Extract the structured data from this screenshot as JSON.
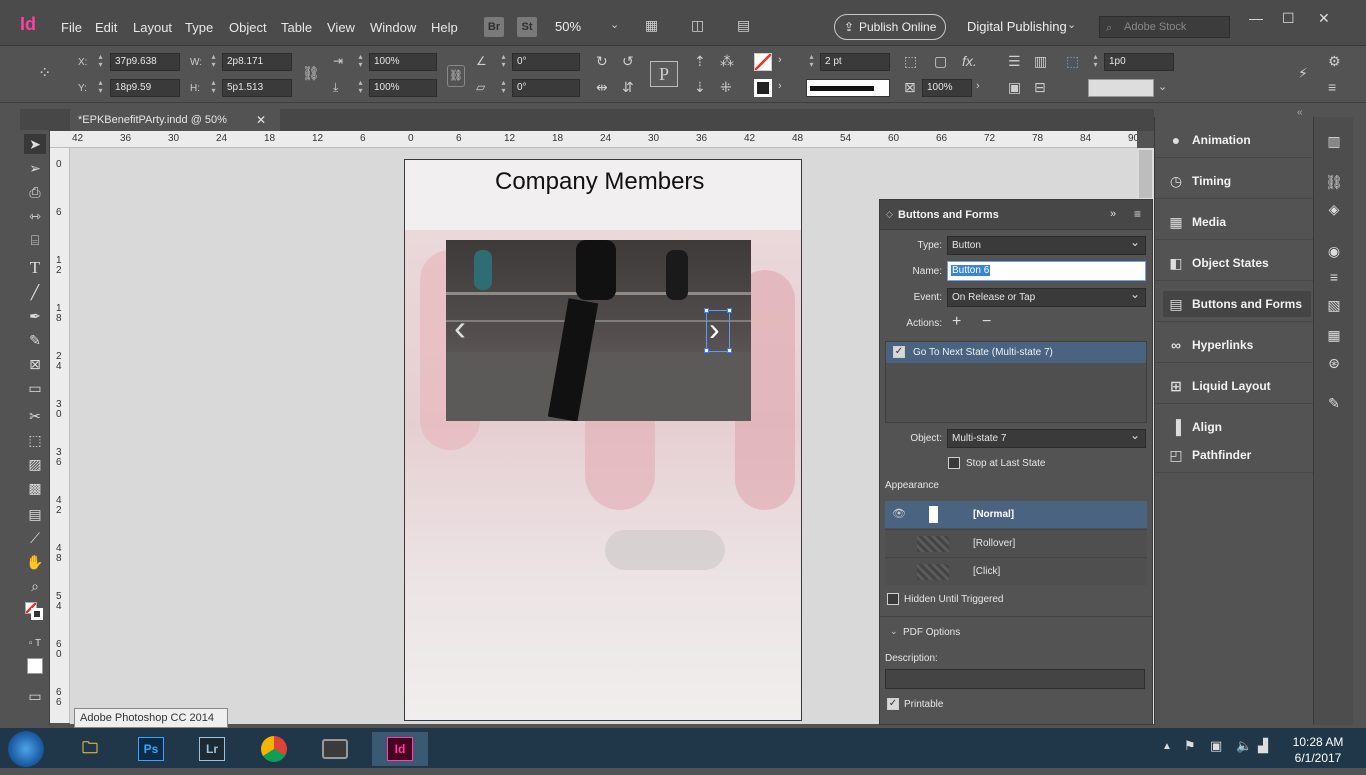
{
  "app": {
    "logo": "Id",
    "menus": [
      "File",
      "Edit",
      "Layout",
      "Type",
      "Object",
      "Table",
      "View",
      "Window",
      "Help"
    ],
    "bridge": "Br",
    "stock": "St",
    "zoom": "50%",
    "publish_label": "Publish Online",
    "workspace": "Digital Publishing",
    "search_placeholder": "Adobe Stock",
    "win_controls": [
      "—",
      "☐",
      "✕"
    ]
  },
  "control": {
    "x_label": "X:",
    "x_value": "37p9.638",
    "y_label": "Y:",
    "y_value": "18p9.59",
    "w_label": "W:",
    "w_value": "2p8.171",
    "h_label": "H:",
    "h_value": "5p1.513",
    "scale_x": "100%",
    "scale_y": "100%",
    "rotate": "0°",
    "shear": "0°",
    "stroke_weight": "2 pt",
    "opacity": "100%",
    "gap": "1p0"
  },
  "doc": {
    "tab_title": "*EPKBenefitPArty.indd @ 50%",
    "page_title": "Company Members",
    "ruler_h": [
      "42",
      "36",
      "30",
      "24",
      "18",
      "12",
      "6",
      "0",
      "6",
      "12",
      "18",
      "24",
      "30",
      "36",
      "42",
      "48",
      "54",
      "60",
      "66",
      "72",
      "78",
      "84",
      "90"
    ],
    "ruler_v": [
      "0",
      "6",
      "1 2",
      "1 8",
      "2 4",
      "3 0",
      "3 6",
      "4 2",
      "4 8",
      "5 4",
      "6 0",
      "6 6"
    ]
  },
  "buttons_panel": {
    "title": "Buttons and Forms",
    "type_label": "Type:",
    "type_value": "Button",
    "name_label": "Name:",
    "name_value": "Button 6",
    "event_label": "Event:",
    "event_value": "On Release or Tap",
    "actions_label": "Actions:",
    "action_item": "Go To Next State (Multi-state 7)",
    "object_label": "Object:",
    "object_value": "Multi-state 7",
    "stop_label": "Stop at Last State",
    "appearance_label": "Appearance",
    "states": [
      "[Normal]",
      "[Rollover]",
      "[Click]"
    ],
    "hidden_label": "Hidden Until Triggered",
    "pdf_options": "PDF Options",
    "description_label": "Description:",
    "printable_label": "Printable"
  },
  "right_panel": {
    "items": [
      "Animation",
      "Timing",
      "Media",
      "Object States",
      "Buttons and Forms",
      "Hyperlinks",
      "Liquid Layout",
      "Align",
      "Pathfinder"
    ],
    "active": "Buttons and Forms"
  },
  "tooltip": "Adobe Photoshop CC 2014",
  "taskbar": {
    "apps": [
      "Ps",
      "Lr",
      "Id"
    ],
    "time": "10:28 AM",
    "date": "6/1/2017"
  },
  "colors": {
    "indesign_pink": "#ff3fa4",
    "panel_bg": "#535353",
    "selected_row": "#4a6380",
    "name_highlight": "#3a84d6"
  }
}
